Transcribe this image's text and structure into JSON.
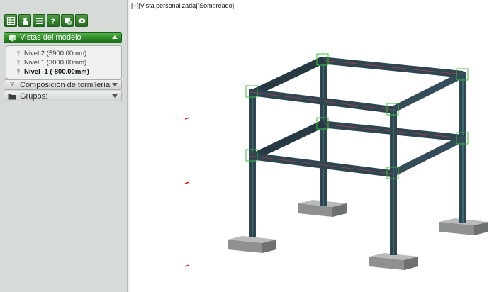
{
  "toolbar": {
    "buttons": [
      {
        "icon": "grid-icon"
      },
      {
        "icon": "person-icon"
      },
      {
        "icon": "list-icon"
      },
      {
        "icon": "help-icon"
      },
      {
        "icon": "tag-icon"
      },
      {
        "icon": "eye-icon"
      }
    ]
  },
  "panels": {
    "views": {
      "label": "Vistas del modelo",
      "items": [
        {
          "label": "Nivel 2 (5900.00mm)",
          "active": false
        },
        {
          "label": "Nivel 1 (3000.00mm)",
          "active": false
        },
        {
          "label": "Nivel -1 (-800.00mm)",
          "active": true
        }
      ]
    },
    "bolts": {
      "label": "Composición de tornillería"
    },
    "groups": {
      "label": "Grupos:"
    }
  },
  "viewport": {
    "label": "[−][Vista personalizada][Sombreado]"
  },
  "colors": {
    "accent": "#2d8a28",
    "steel": "#2f4650",
    "highlight": "#3bbf3b",
    "marker": "#e02020",
    "footing": "#8f9190"
  }
}
